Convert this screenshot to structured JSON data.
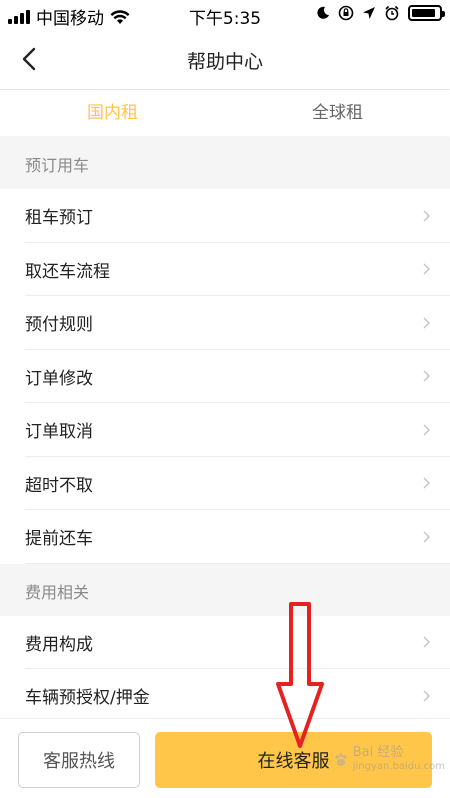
{
  "status_bar": {
    "carrier": "中国移动",
    "time": "下午5:35",
    "wifi_icon": "wifi-icon",
    "icons": [
      "moon-icon",
      "orientation-lock-icon",
      "location-icon",
      "alarm-icon",
      "battery-icon"
    ],
    "battery_level": 0.9
  },
  "nav": {
    "title": "帮助中心",
    "back_icon": "chevron-left-icon"
  },
  "tabs": [
    {
      "label": "国内租",
      "active": true
    },
    {
      "label": "全球租",
      "active": false
    }
  ],
  "sections": [
    {
      "title": "预订用车",
      "items": [
        "租车预订",
        "取还车流程",
        "预付规则",
        "订单修改",
        "订单取消",
        "超时不取",
        "提前还车"
      ]
    },
    {
      "title": "费用相关",
      "items": [
        "费用构成",
        "车辆预授权/押金"
      ]
    }
  ],
  "bottom": {
    "hotline_label": "客服热线",
    "online_label": "在线客服"
  },
  "watermark": {
    "line1": "Bai",
    "line2": "经验",
    "line3": "jingyan.baidu.com"
  },
  "colors": {
    "accent": "#ffc64a",
    "annotation_arrow": "#e52222"
  }
}
